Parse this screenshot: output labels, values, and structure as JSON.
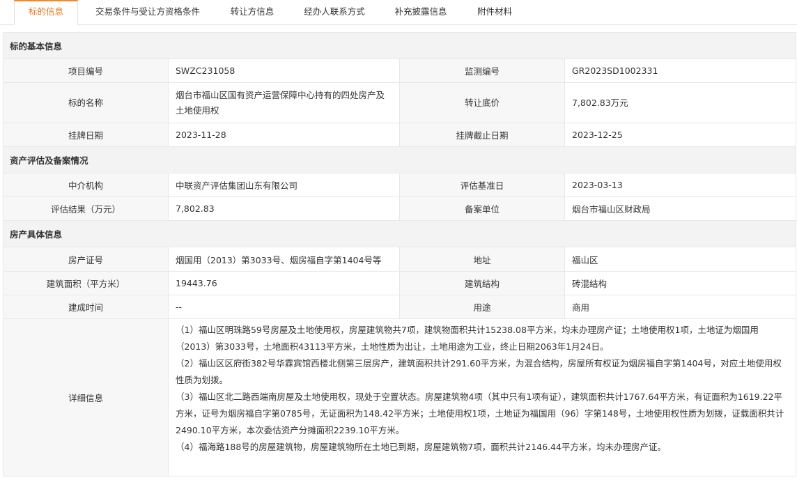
{
  "tabs": [
    {
      "label": "标的信息",
      "active": true
    },
    {
      "label": "交易条件与受让方资格条件",
      "active": false
    },
    {
      "label": "转让方信息",
      "active": false
    },
    {
      "label": "经办人联系方式",
      "active": false
    },
    {
      "label": "补充披露信息",
      "active": false
    },
    {
      "label": "附件材料",
      "active": false
    }
  ],
  "sections": {
    "basic": {
      "title": "标的基本信息",
      "rows": [
        {
          "l1": "项目编号",
          "v1": "SWZC231058",
          "l2": "监测编号",
          "v2": "GR2023SD1002331"
        },
        {
          "l1": "标的名称",
          "v1": "烟台市福山区国有资产运营保障中心持有的四处房产及土地使用权",
          "l2": "转让底价",
          "v2": "7,802.83万元"
        },
        {
          "l1": "挂牌日期",
          "v1": "2023-11-28",
          "l2": "挂牌截止日期",
          "v2": "2023-12-25"
        }
      ]
    },
    "assess": {
      "title": "资产评估及备案情况",
      "rows": [
        {
          "l1": "中介机构",
          "v1": "中联资产评估集团山东有限公司",
          "l2": "评估基准日",
          "v2": "2023-03-13"
        },
        {
          "l1": "评估结果（万元）",
          "v1": "7,802.83",
          "l2": "备案单位",
          "v2": "烟台市福山区财政局"
        }
      ]
    },
    "property": {
      "title": "房产具体信息",
      "rows": [
        {
          "l1": "房产证号",
          "v1": "烟国用（2013）第3033号、烟房福自字第1404号等",
          "l2": "地址",
          "v2": "福山区"
        },
        {
          "l1": "建筑面积（平方米）",
          "v1": "19443.76",
          "l2": "建筑结构",
          "v2": "砖混结构"
        },
        {
          "l1": "建成时间",
          "v1": "--",
          "l2": "用途",
          "v2": "商用"
        }
      ],
      "detail_label": "详细信息",
      "detail_lines": [
        "（1）福山区明珠路59号房屋及土地使用权，房屋建筑物共7项，建筑物面积共计15238.08平方米，均未办理房产证；土地使用权1项，土地证为烟国用（2013）第3033号，土地面积43113平方米，土地性质为出让，土地用途为工业，终止日期2063年1月24日。",
        "（2）福山区区府街382号华霖宾馆西楼北侧第三层房产，建筑面积共计291.60平方米，为混合结构，房屋所有权证为烟房福自字第1404号，对应土地使用权性质为划拨。",
        "（3）福山区北二路西端南房屋及土地使用权，现处于空置状态。房屋建筑物4项（其中只有1项有证），建筑面积共计1767.64平方米，有证面积为1619.22平方米，证号为烟房福自字第0785号，无证面积为148.42平方米；土地使用权1项，土地证为福国用（96）字第148号，土地使用权性质为划拨，证载面积共计2490.10平方米，本次委估资产分摊面积2239.10平方米。",
        "（4）福海路188号的房屋建筑物，房屋建筑物所在土地已到期，房屋建筑物7项，面积共计2146.44平方米，均未办理房产证。"
      ]
    }
  },
  "colors": {
    "accent": "#f08a2c",
    "accent_text": "#e57a1f",
    "label_bg": "#f7f7f7",
    "section_bg": "#f3f3f3",
    "border": "#e8e8e8"
  }
}
